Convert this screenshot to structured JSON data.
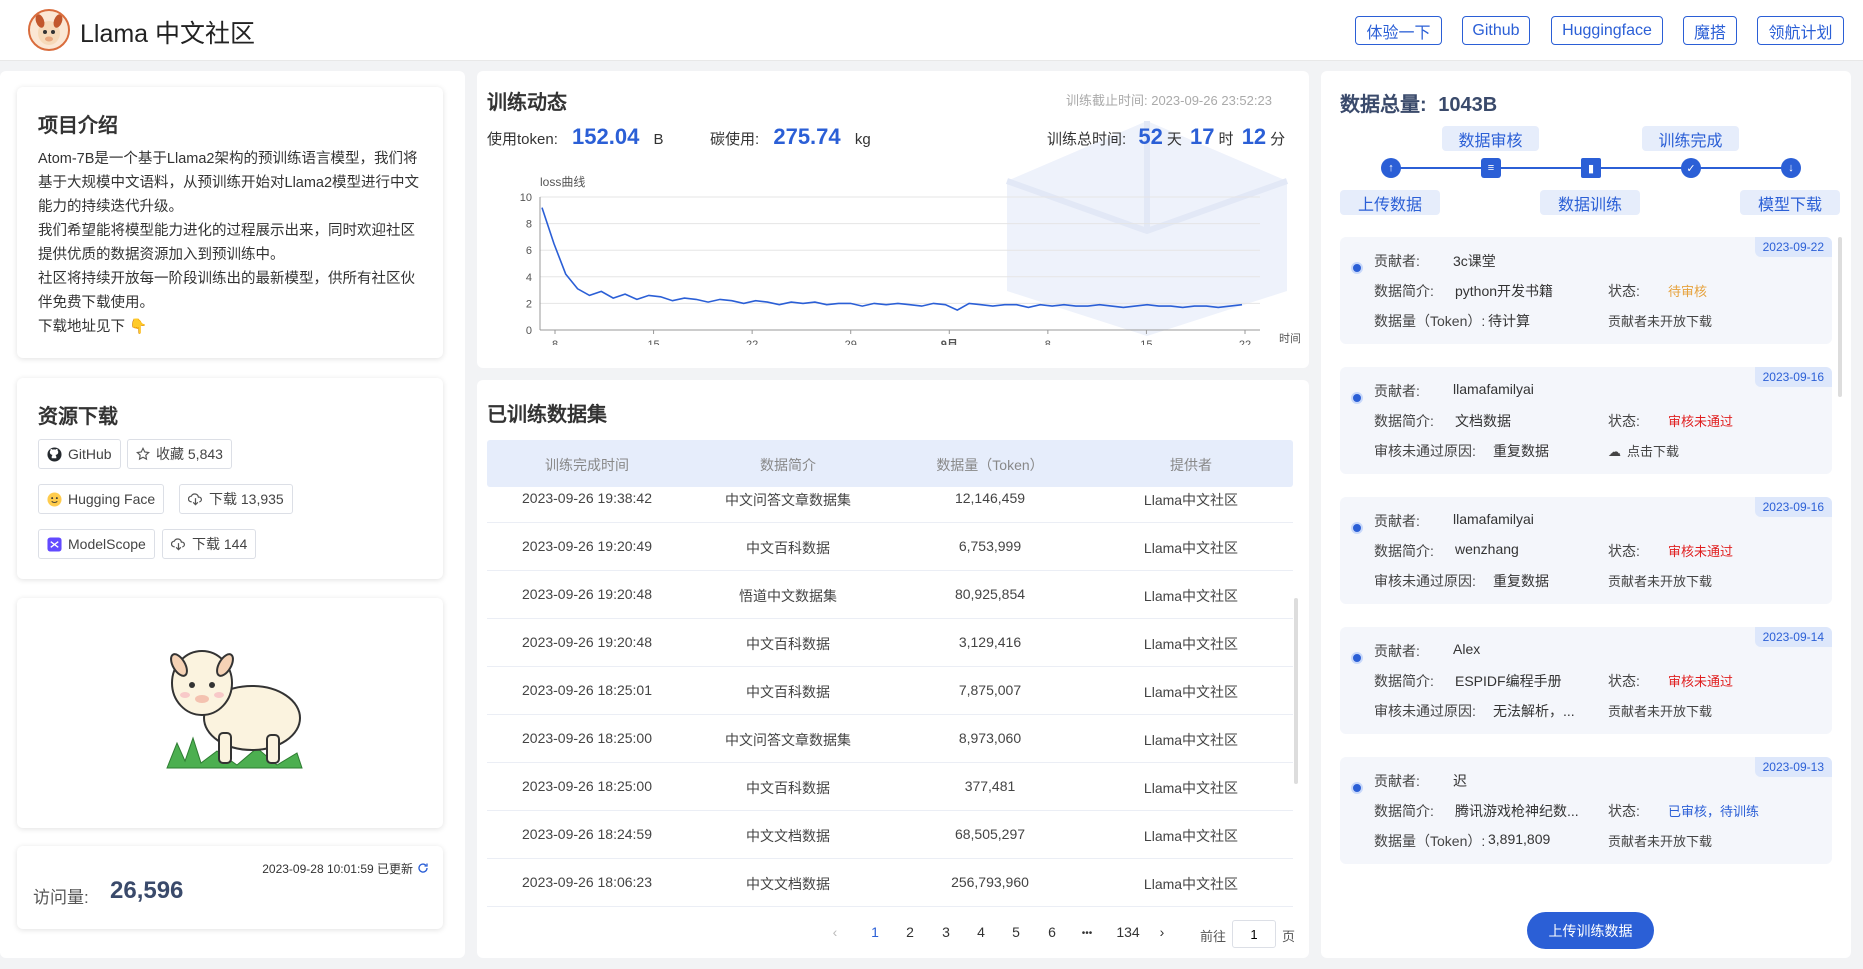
{
  "header": {
    "title": "Llama 中文社区",
    "nav": [
      "体验一下",
      "Github",
      "Huggingface",
      "魔搭",
      "领航计划"
    ]
  },
  "intro": {
    "title": "项目介绍",
    "paragraphs": [
      "Atom-7B是一个基于Llama2架构的预训练语言模型，我们将基于大规模中文语料，从预训练开始对Llama2模型进行中文能力的持续迭代升级。",
      "我们希望能将模型能力进化的过程展示出来，同时欢迎社区提供优质的数据资源加入到预训练中。",
      "社区将持续开放每一阶段训练出的最新模型，供所有社区伙伴免费下载使用。",
      "下载地址见下 👇"
    ]
  },
  "resources": {
    "title": "资源下载",
    "github": "GitHub",
    "github_star": "收藏 5,843",
    "hf": "Hugging Face",
    "hf_dl": "下载 13,935",
    "ms": "ModelScope",
    "ms_dl": "下载 144"
  },
  "visits": {
    "updated": "2023-09-28 10:01:59 已更新",
    "label": "访问量:",
    "value": "26,596"
  },
  "training": {
    "title": "训练动态",
    "deadline": "训练截止时间: 2023-09-26 23:52:23",
    "token_label": "使用token:",
    "token_value": "152.04",
    "token_unit": "B",
    "carbon_label": "碳使用:",
    "carbon_value": "275.74",
    "carbon_unit": "kg",
    "time_label": "训练总时间:",
    "days": "52",
    "days_unit": "天",
    "hours": "17",
    "hours_unit": "时",
    "mins": "12",
    "mins_unit": "分"
  },
  "chart_data": {
    "type": "line",
    "title": "loss曲线",
    "xlabel": "时间",
    "ylabel": "",
    "ylim": [
      0,
      10
    ],
    "yticks": [
      0,
      2,
      4,
      6,
      8,
      10
    ],
    "xticks": [
      "8",
      "15",
      "22",
      "29",
      "9月",
      "8",
      "15",
      "22"
    ],
    "series": [
      {
        "name": "",
        "values": [
          9.2,
          6.5,
          4.2,
          3.1,
          2.6,
          2.9,
          2.4,
          2.7,
          2.3,
          2.6,
          2.5,
          2.2,
          2.4,
          2.3,
          2.1,
          2.3,
          2.2,
          2.0,
          2.2,
          2.1,
          1.9,
          2.1,
          2.0,
          2.1,
          1.9,
          2.0,
          2.0,
          1.8,
          2.0,
          1.9,
          2.0,
          1.9,
          1.8,
          2.0,
          1.9,
          1.5,
          2.0,
          1.9,
          1.8,
          1.9,
          1.9,
          1.7,
          1.9,
          1.8,
          1.9,
          1.8,
          1.8,
          1.9,
          1.8,
          1.7,
          1.8,
          1.9,
          1.8,
          1.8,
          1.7,
          1.8,
          1.8,
          1.7,
          1.8,
          1.9
        ]
      }
    ]
  },
  "datasets": {
    "title": "已训练数据集",
    "columns": [
      "训练完成时间",
      "数据简介",
      "数据量（Token）",
      "提供者"
    ],
    "rows": [
      [
        "2023-09-26 19:38:42",
        "中文问答文章数据集",
        "12,146,459",
        "Llama中文社区"
      ],
      [
        "2023-09-26 19:20:49",
        "中文百科数据",
        "6,753,999",
        "Llama中文社区"
      ],
      [
        "2023-09-26 19:20:48",
        "悟道中文数据集",
        "80,925,854",
        "Llama中文社区"
      ],
      [
        "2023-09-26 19:20:48",
        "中文百科数据",
        "3,129,416",
        "Llama中文社区"
      ],
      [
        "2023-09-26 18:25:01",
        "中文百科数据",
        "7,875,007",
        "Llama中文社区"
      ],
      [
        "2023-09-26 18:25:00",
        "中文问答文章数据集",
        "8,973,060",
        "Llama中文社区"
      ],
      [
        "2023-09-26 18:25:00",
        "中文百科数据",
        "377,481",
        "Llama中文社区"
      ],
      [
        "2023-09-26 18:24:59",
        "中文文档数据",
        "68,505,297",
        "Llama中文社区"
      ],
      [
        "2023-09-26 18:06:23",
        "中文文档数据",
        "256,793,960",
        "Llama中文社区"
      ]
    ],
    "pagination": {
      "pages": [
        "1",
        "2",
        "3",
        "4",
        "5",
        "6",
        "•••",
        "134"
      ],
      "goto_label": "前往",
      "goto_value": "1",
      "page_unit": "页"
    }
  },
  "data_total": {
    "label": "数据总量:",
    "value": "1043B",
    "steps_top": [
      "数据审核",
      "训练完成"
    ],
    "steps_bottom": [
      "上传数据",
      "数据训练",
      "模型下载"
    ]
  },
  "contributions": [
    {
      "date": "2023-09-22",
      "contributor_label": "贡献者:",
      "contributor": "3c课堂",
      "desc_label": "数据简介:",
      "desc": "python开发书籍",
      "status_label": "状态:",
      "status": "待审核",
      "status_color": "#e6a23c",
      "third_label": "数据量（Token）:",
      "third_value": "待计算",
      "action": "贡献者未开放下载"
    },
    {
      "date": "2023-09-16",
      "contributor_label": "贡献者:",
      "contributor": "llamafamilyai",
      "desc_label": "数据简介:",
      "desc": "文档数据",
      "status_label": "状态:",
      "status": "审核未通过",
      "status_color": "#e02020",
      "third_label": "审核未通过原因:",
      "third_value": "重复数据",
      "action": "点击下载"
    },
    {
      "date": "2023-09-16",
      "contributor_label": "贡献者:",
      "contributor": "llamafamilyai",
      "desc_label": "数据简介:",
      "desc": "wenzhang",
      "status_label": "状态:",
      "status": "审核未通过",
      "status_color": "#e02020",
      "third_label": "审核未通过原因:",
      "third_value": "重复数据",
      "action": "贡献者未开放下载"
    },
    {
      "date": "2023-09-14",
      "contributor_label": "贡献者:",
      "contributor": "Alex",
      "desc_label": "数据简介:",
      "desc": "ESPIDF编程手册",
      "status_label": "状态:",
      "status": "审核未通过",
      "status_color": "#e02020",
      "third_label": "审核未通过原因:",
      "third_value": "无法解析，...",
      "action": "贡献者未开放下载"
    },
    {
      "date": "2023-09-13",
      "contributor_label": "贡献者:",
      "contributor": "迟",
      "desc_label": "数据简介:",
      "desc": "腾讯游戏枪神纪数...",
      "status_label": "状态:",
      "status": "已审核，待训练",
      "status_color": "#2b5fd6",
      "third_label": "数据量（Token）:",
      "third_value": "3,891,809",
      "action": "贡献者未开放下载"
    }
  ],
  "upload_button": "上传训练数据"
}
